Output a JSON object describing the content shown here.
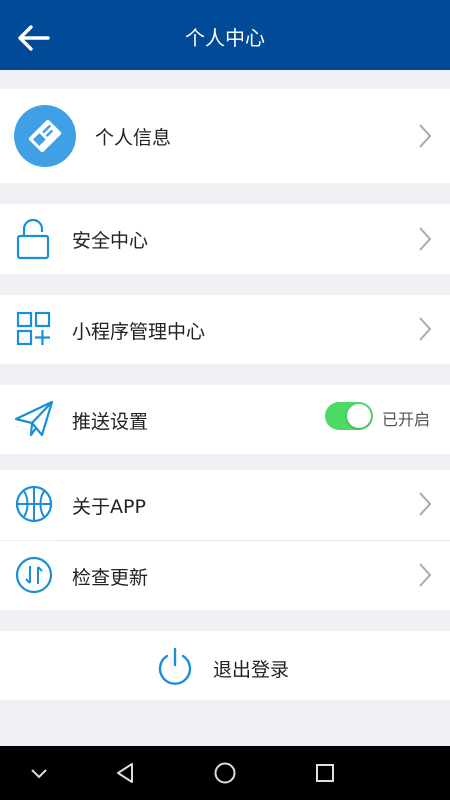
{
  "header": {
    "title": "个人中心"
  },
  "profile": {
    "label": "个人信息"
  },
  "menu": {
    "security": "安全中心",
    "mini_program": "小程序管理中心",
    "push": "推送设置",
    "push_status": "已开启",
    "about": "关于APP",
    "update": "检查更新"
  },
  "logout": {
    "label": "退出登录"
  },
  "colors": {
    "header": "#004a97",
    "accent": "#1a8fd8",
    "toggle_on": "#4cd964"
  },
  "icons": [
    "back-arrow-icon",
    "id-card-icon",
    "lock-icon",
    "grid-plus-icon",
    "paper-plane-icon",
    "basketball-icon",
    "refresh-arrows-icon",
    "power-icon",
    "chevron-right-icon"
  ]
}
